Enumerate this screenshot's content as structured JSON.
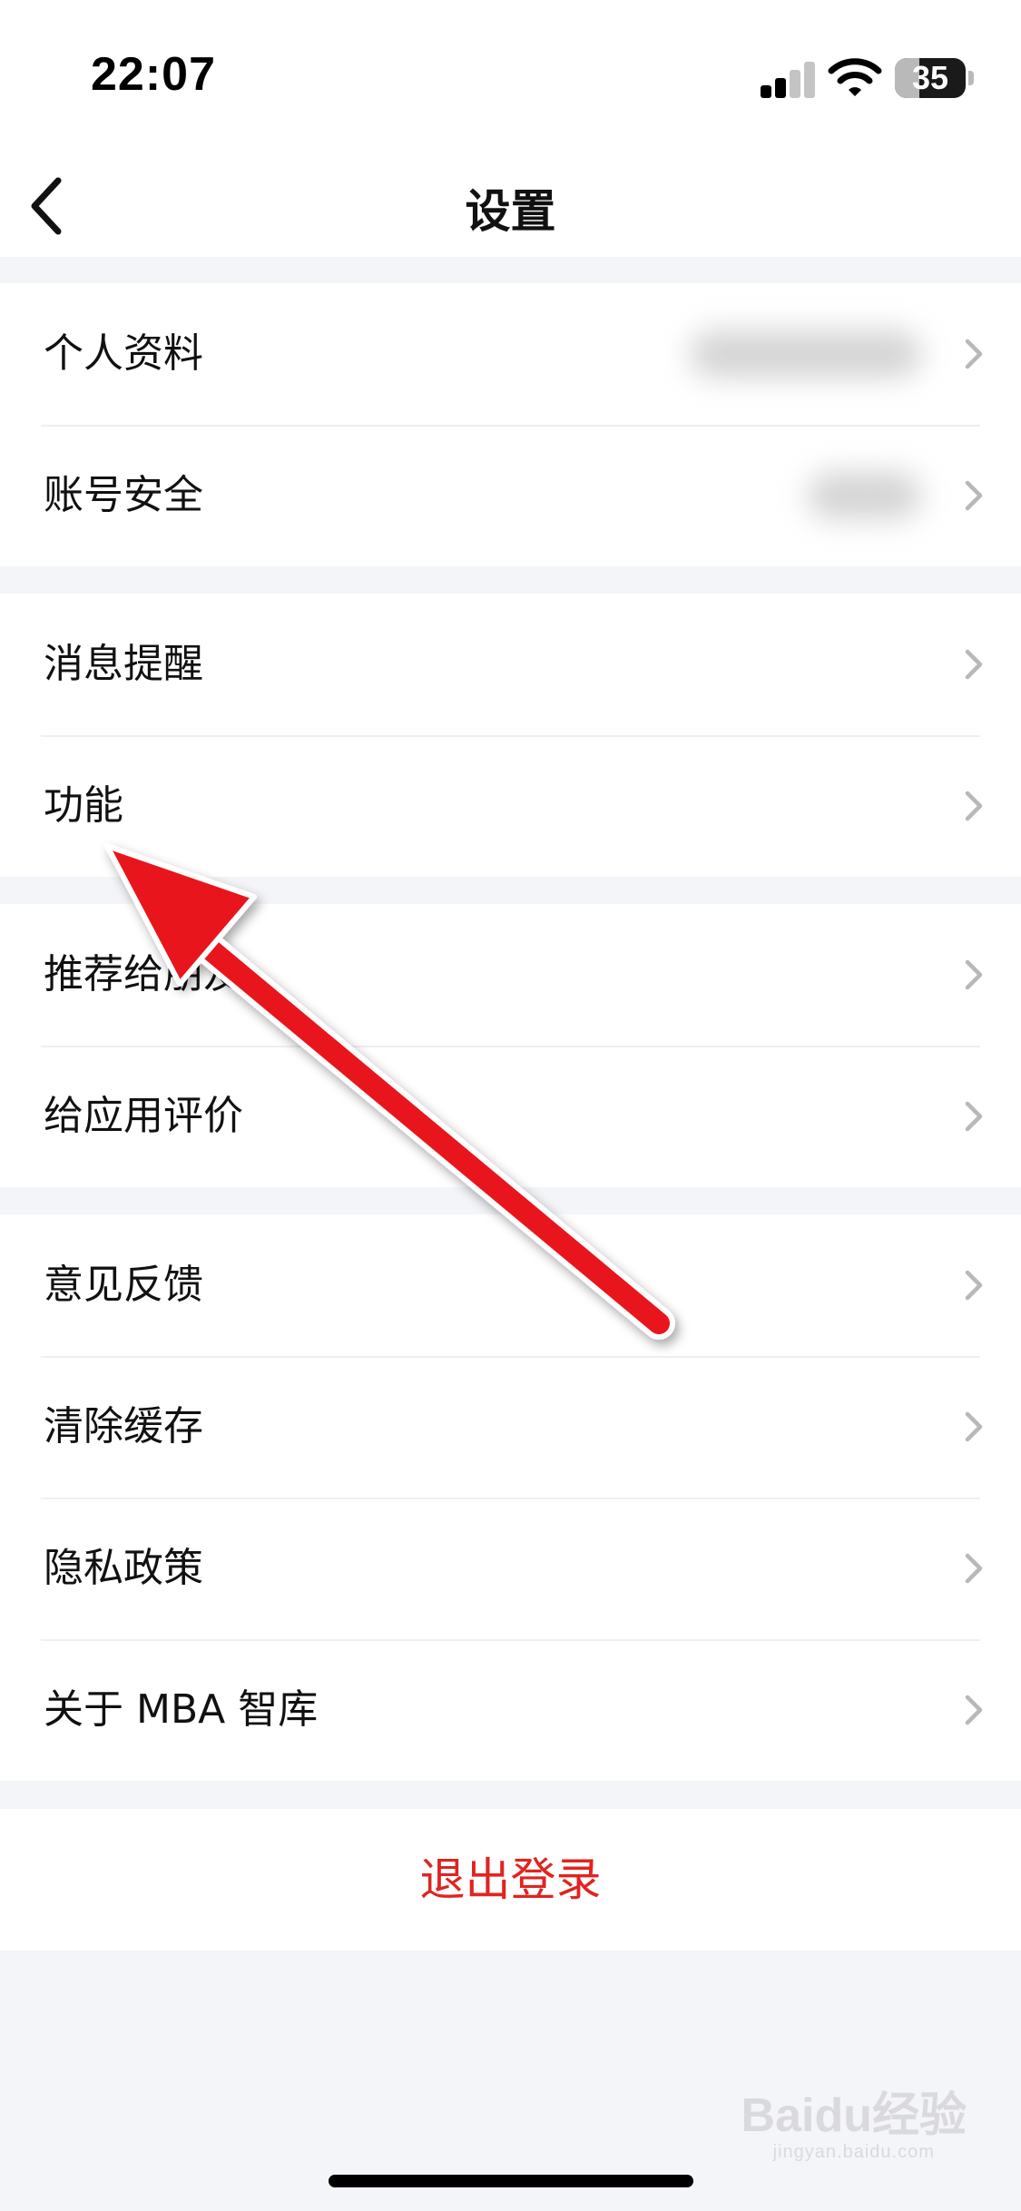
{
  "status_bar": {
    "time": "22:07",
    "battery_level": "35",
    "icons": [
      "signal-icon",
      "wifi-icon",
      "battery-icon"
    ]
  },
  "nav": {
    "title": "设置",
    "back_icon": "chevron-left-icon"
  },
  "sections": [
    {
      "items": [
        {
          "label": "个人资料"
        },
        {
          "label": "账号安全"
        }
      ]
    },
    {
      "items": [
        {
          "label": "消息提醒"
        },
        {
          "label": "功能"
        }
      ]
    },
    {
      "items": [
        {
          "label": "推荐给朋友"
        },
        {
          "label": "给应用评价"
        }
      ]
    },
    {
      "items": [
        {
          "label": "意见反馈"
        },
        {
          "label": "清除缓存"
        },
        {
          "label": "隐私政策"
        },
        {
          "label": "关于 MBA 智库"
        }
      ]
    }
  ],
  "logout": {
    "label": "退出登录"
  },
  "colors": {
    "background": "#f4f5f9",
    "card": "#ffffff",
    "logout_text": "#e02420",
    "annotation_arrow": "#e8141c"
  },
  "watermark": {
    "brand": "Baidu经验",
    "sub": "jingyan.baidu.com"
  }
}
